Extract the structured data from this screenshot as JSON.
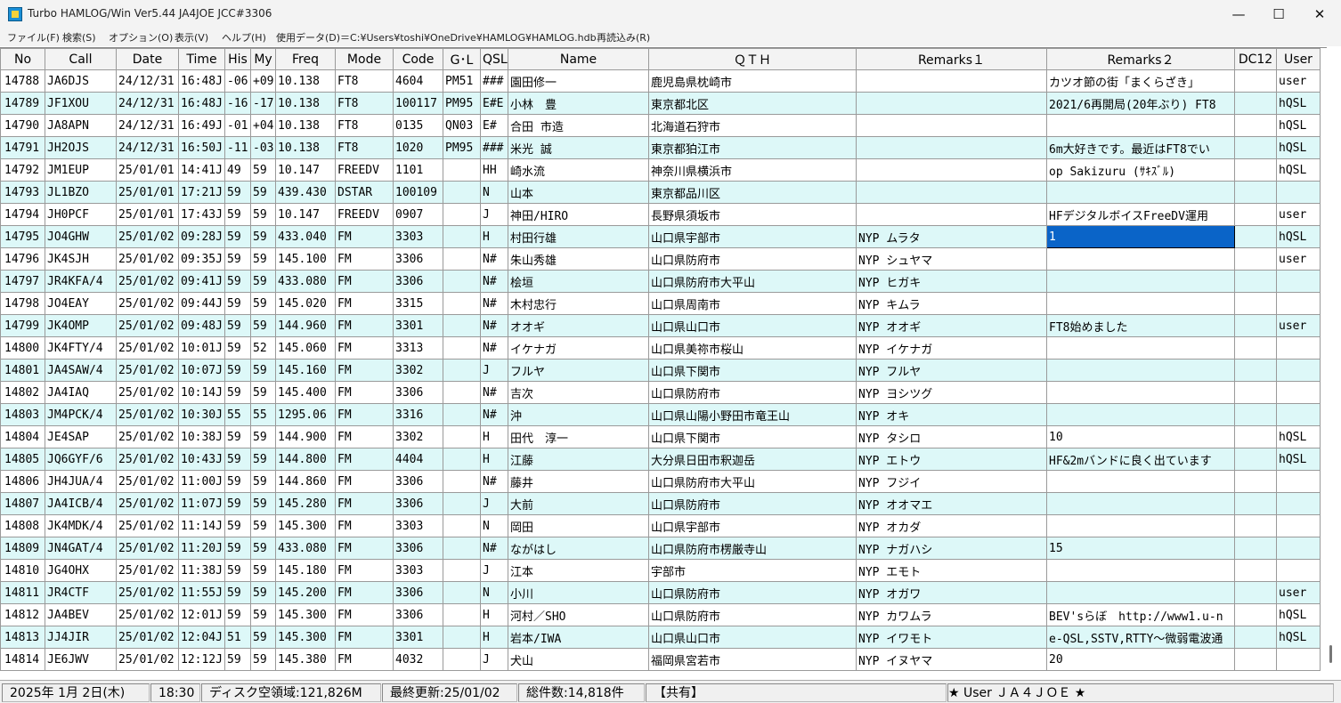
{
  "window": {
    "title": "Turbo HAMLOG/Win Ver5.44 JA4JOE JCC#3306",
    "minimize": "—",
    "maximize": "☐",
    "close": "✕"
  },
  "menu": [
    "ファイル(F)",
    "検索(S)",
    "オプション(O)",
    "表示(V)",
    "ヘルプ(H)",
    "使用データ(D)＝C:¥Users¥toshi¥OneDrive¥HAMLOG¥HAMLOG.hdb",
    "再読込み(R)"
  ],
  "table": {
    "columns": [
      "No",
      "Call",
      "Date",
      "Time",
      "His",
      "My",
      "Freq",
      "Mode",
      "Code",
      "G･L",
      "QSL",
      "Name",
      "ＱＴＨ",
      "Remarks１",
      "Remarks２",
      "DC12",
      "User"
    ],
    "rows": [
      [
        "14788",
        "JA6DJS",
        "24/12/31",
        "16:48J",
        "-06",
        "+09",
        "10.138",
        "FT8",
        "4604",
        "PM51",
        "###",
        "園田修一",
        "鹿児島県枕崎市",
        "",
        "カツオ節の街「まくらざき」",
        "",
        "user"
      ],
      [
        "14789",
        "JF1XOU",
        "24/12/31",
        "16:48J",
        "-16",
        "-17",
        "10.138",
        "FT8",
        "100117",
        "PM95",
        "E#E",
        "小林　豊",
        "東京都北区",
        "",
        "2021/6再開局(20年ぶり) FT8",
        "",
        "hQSL"
      ],
      [
        "14790",
        "JA8APN",
        "24/12/31",
        "16:49J",
        "-01",
        "+04",
        "10.138",
        "FT8",
        "0135",
        "QN03",
        "E#",
        "合田 市造",
        "北海道石狩市",
        "",
        "",
        "",
        "hQSL"
      ],
      [
        "14791",
        "JH2OJS",
        "24/12/31",
        "16:50J",
        "-11",
        "-03",
        "10.138",
        "FT8",
        "1020",
        "PM95",
        "###",
        "米光 誠",
        "東京都狛江市",
        "",
        "6m大好きです。最近はFT8でい",
        "",
        "hQSL"
      ],
      [
        "14792",
        "JM1EUP",
        "25/01/01",
        "14:41J",
        "49",
        "59",
        "10.147",
        "FREEDV",
        "1101",
        "",
        "HH",
        "崎水流",
        "神奈川県横浜市",
        "",
        "op Sakizuru (ｻｷｽﾞﾙ)",
        "",
        "hQSL"
      ],
      [
        "14793",
        "JL1BZO",
        "25/01/01",
        "17:21J",
        "59",
        "59",
        "439.430",
        "DSTAR",
        "100109",
        "",
        "N",
        "山本",
        "東京都品川区",
        "",
        "",
        "",
        ""
      ],
      [
        "14794",
        "JH0PCF",
        "25/01/01",
        "17:43J",
        "59",
        "59",
        "10.147",
        "FREEDV",
        "0907",
        "",
        "J",
        "神田/HIRO",
        "長野県須坂市",
        "",
        "HFデジタルボイスFreeDV運用",
        "",
        "user"
      ],
      [
        "14795",
        "JO4GHW",
        "25/01/02",
        "09:28J",
        "59",
        "59",
        "433.040",
        "FM",
        "3303",
        "",
        "H",
        "村田行雄",
        "山口県宇部市",
        "NYP ムラタ",
        "1",
        "",
        "hQSL"
      ],
      [
        "14796",
        "JK4SJH",
        "25/01/02",
        "09:35J",
        "59",
        "59",
        "145.100",
        "FM",
        "3306",
        "",
        "N#",
        "朱山秀雄",
        "山口県防府市",
        "NYP シュヤマ",
        "",
        "",
        "user"
      ],
      [
        "14797",
        "JR4KFA/4",
        "25/01/02",
        "09:41J",
        "59",
        "59",
        "433.080",
        "FM",
        "3306",
        "",
        "N#",
        "桧垣",
        "山口県防府市大平山",
        "NYP ヒガキ",
        "",
        "",
        ""
      ],
      [
        "14798",
        "JO4EAY",
        "25/01/02",
        "09:44J",
        "59",
        "59",
        "145.020",
        "FM",
        "3315",
        "",
        "N#",
        "木村忠行",
        "山口県周南市",
        "NYP キムラ",
        "",
        "",
        ""
      ],
      [
        "14799",
        "JK4OMP",
        "25/01/02",
        "09:48J",
        "59",
        "59",
        "144.960",
        "FM",
        "3301",
        "",
        "N#",
        "オオギ",
        "山口県山口市",
        "NYP オオギ",
        "FT8始めました",
        "",
        "user"
      ],
      [
        "14800",
        "JK4FTY/4",
        "25/01/02",
        "10:01J",
        "59",
        "52",
        "145.060",
        "FM",
        "3313",
        "",
        "N#",
        "イケナガ",
        "山口県美祢市桜山",
        "NYP イケナガ",
        "",
        "",
        ""
      ],
      [
        "14801",
        "JA4SAW/4",
        "25/01/02",
        "10:07J",
        "59",
        "59",
        "145.160",
        "FM",
        "3302",
        "",
        "J",
        "フルヤ",
        "山口県下関市",
        "NYP フルヤ",
        "",
        "",
        ""
      ],
      [
        "14802",
        "JA4IAQ",
        "25/01/02",
        "10:14J",
        "59",
        "59",
        "145.400",
        "FM",
        "3306",
        "",
        "N#",
        "吉次",
        "山口県防府市",
        "NYP ヨシツグ",
        "",
        "",
        ""
      ],
      [
        "14803",
        "JM4PCK/4",
        "25/01/02",
        "10:30J",
        "55",
        "55",
        "1295.06",
        "FM",
        "3316",
        "",
        "N#",
        "沖",
        "山口県山陽小野田市竜王山",
        "NYP オキ",
        "",
        "",
        ""
      ],
      [
        "14804",
        "JE4SAP",
        "25/01/02",
        "10:38J",
        "59",
        "59",
        "144.900",
        "FM",
        "3302",
        "",
        "H",
        "田代　淳一",
        "山口県下関市",
        "NYP タシロ",
        "10",
        "",
        "hQSL"
      ],
      [
        "14805",
        "JQ6GYF/6",
        "25/01/02",
        "10:43J",
        "59",
        "59",
        "144.800",
        "FM",
        "4404",
        "",
        "H",
        "江藤",
        "大分県日田市釈迦岳",
        "NYP エトウ",
        "HF&2mバンドに良く出ています",
        "",
        "hQSL"
      ],
      [
        "14806",
        "JH4JUA/4",
        "25/01/02",
        "11:00J",
        "59",
        "59",
        "144.860",
        "FM",
        "3306",
        "",
        "N#",
        "藤井",
        "山口県防府市大平山",
        "NYP フジイ",
        "",
        "",
        ""
      ],
      [
        "14807",
        "JA4ICB/4",
        "25/01/02",
        "11:07J",
        "59",
        "59",
        "145.280",
        "FM",
        "3306",
        "",
        "J",
        "大前",
        "山口県防府市",
        "NYP オオマエ",
        "",
        "",
        ""
      ],
      [
        "14808",
        "JK4MDK/4",
        "25/01/02",
        "11:14J",
        "59",
        "59",
        "145.300",
        "FM",
        "3303",
        "",
        "N",
        "岡田",
        "山口県宇部市",
        "NYP オカダ",
        "",
        "",
        ""
      ],
      [
        "14809",
        "JN4GAT/4",
        "25/01/02",
        "11:20J",
        "59",
        "59",
        "433.080",
        "FM",
        "3306",
        "",
        "N#",
        "ながはし",
        "山口県防府市楞厳寺山",
        "NYP ナガハシ",
        "15",
        "",
        ""
      ],
      [
        "14810",
        "JG4OHX",
        "25/01/02",
        "11:38J",
        "59",
        "59",
        "145.180",
        "FM",
        "3303",
        "",
        "J",
        "江本",
        "宇部市",
        "NYP エモト",
        "",
        "",
        ""
      ],
      [
        "14811",
        "JR4CTF",
        "25/01/02",
        "11:55J",
        "59",
        "59",
        "145.200",
        "FM",
        "3306",
        "",
        "N",
        "小川",
        "山口県防府市",
        "NYP オガワ",
        "",
        "",
        "user"
      ],
      [
        "14812",
        "JA4BEV",
        "25/01/02",
        "12:01J",
        "59",
        "59",
        "145.300",
        "FM",
        "3306",
        "",
        "H",
        "河村／SHO",
        "山口県防府市",
        "NYP カワムラ",
        "BEV'sらぼ　http://www1.u-n",
        "",
        "hQSL"
      ],
      [
        "14813",
        "JJ4JIR",
        "25/01/02",
        "12:04J",
        "51",
        "59",
        "145.300",
        "FM",
        "3301",
        "",
        "H",
        "岩本/IWA",
        "山口県山口市",
        "NYP イワモト",
        "e-QSL,SSTV,RTTY～微弱電波通",
        "",
        "hQSL"
      ],
      [
        "14814",
        "JE6JWV",
        "25/01/02",
        "12:12J",
        "59",
        "59",
        "145.380",
        "FM",
        "4032",
        "",
        "J",
        "犬山",
        "福岡県宮若市",
        "NYP イヌヤマ",
        "20",
        "",
        ""
      ]
    ]
  },
  "status": {
    "date": "2025年 1月 2日(木)",
    "time": "18:30",
    "disk": "ディスク空領域:121,826M",
    "update": "最終更新:25/01/02",
    "total": "総件数:14,818件",
    "share": "【共有】",
    "user": "★ User ＪＡ４ＪＯＥ ★"
  }
}
